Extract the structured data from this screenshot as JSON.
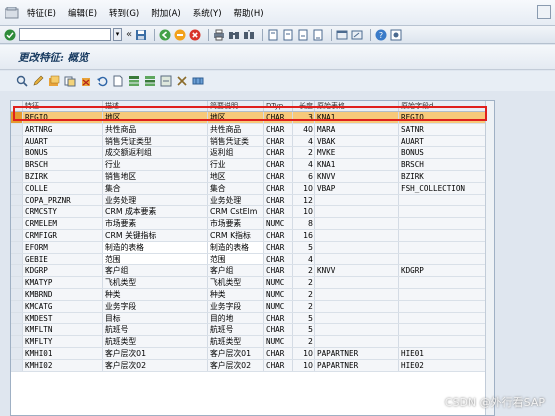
{
  "menu": {
    "items": [
      "特征(E)",
      "编辑(E)",
      "转到(G)",
      "附加(A)",
      "系统(Y)",
      "帮助(H)"
    ]
  },
  "toolbar": {
    "command_value": "",
    "double_arrow": "«"
  },
  "title": "更改特征: 概览",
  "grid": {
    "columns": [
      "特征",
      "描述",
      "简要说明",
      "DTyp",
      "长度",
      "原始表格",
      "原始字段d"
    ],
    "rows": [
      [
        "REGIO",
        "地区",
        "地区",
        "CHAR",
        "3",
        "KNA1",
        "REGIO"
      ],
      [
        "ARTNRG",
        "共性商品",
        "共性商品",
        "CHAR",
        "40",
        "MARA",
        "SATNR"
      ],
      [
        "AUART",
        "销售凭证类型",
        "销售凭证类",
        "CHAR",
        "4",
        "VBAK",
        "AUART"
      ],
      [
        "BONUS",
        "成交额返利组",
        "返利组",
        "CHAR",
        "2",
        "MVKE",
        "BONUS"
      ],
      [
        "BRSCH",
        "行业",
        "行业",
        "CHAR",
        "4",
        "KNA1",
        "BRSCH"
      ],
      [
        "BZIRK",
        "销售地区",
        "地区",
        "CHAR",
        "6",
        "KNVV",
        "BZIRK"
      ],
      [
        "COLLE",
        "集合",
        "集合",
        "CHAR",
        "10",
        "VBAP",
        "FSH_COLLECTION"
      ],
      [
        "COPA_PRZNR",
        "业务处理",
        "业务处理",
        "CHAR",
        "12",
        "",
        ""
      ],
      [
        "CRMCSTY",
        "CRM 成本要素",
        "CRM CstElm",
        "CHAR",
        "10",
        "",
        ""
      ],
      [
        "CRMELEM",
        "市场要素",
        "市场要素",
        "NUMC",
        "8",
        "",
        ""
      ],
      [
        "CRMFIGR",
        "CRM 关键指标",
        "CRM K指标",
        "CHAR",
        "16",
        "",
        ""
      ],
      [
        "EFORM",
        "制造的表格",
        "制造的表格",
        "CHAR",
        "5",
        "",
        ""
      ],
      [
        "GEBIE",
        "范围",
        "范围",
        "CHAR",
        "4",
        "",
        ""
      ],
      [
        "KDGRP",
        "客户组",
        "客户组",
        "CHAR",
        "2",
        "KNVV",
        "KDGRP"
      ],
      [
        "KMATYP",
        "飞机类型",
        "飞机类型",
        "NUMC",
        "2",
        "",
        ""
      ],
      [
        "KMBRND",
        "种类",
        "种类",
        "NUMC",
        "2",
        "",
        ""
      ],
      [
        "KMCATG",
        "业务字段",
        "业务字段",
        "NUMC",
        "2",
        "",
        ""
      ],
      [
        "KMDEST",
        "目标",
        "目的地",
        "CHAR",
        "5",
        "",
        ""
      ],
      [
        "KMFLTN",
        "航班号",
        "航班号",
        "CHAR",
        "5",
        "",
        ""
      ],
      [
        "KMFLTY",
        "航班类型",
        "航班类型",
        "NUMC",
        "2",
        "",
        ""
      ],
      [
        "KMHI01",
        "客户层次01",
        "客户层次01",
        "CHAR",
        "10",
        "PAPARTNER",
        "HIE01"
      ],
      [
        "KMHI02",
        "客户层次02",
        "客户层次02",
        "CHAR",
        "10",
        "PAPARTNER",
        "HIE02"
      ]
    ]
  },
  "watermark": "CSDN @外行看SAP",
  "colors": {
    "highlight_row": "#f7c97a",
    "highlight_border": "#e0201c",
    "title_text": "#16395f"
  }
}
